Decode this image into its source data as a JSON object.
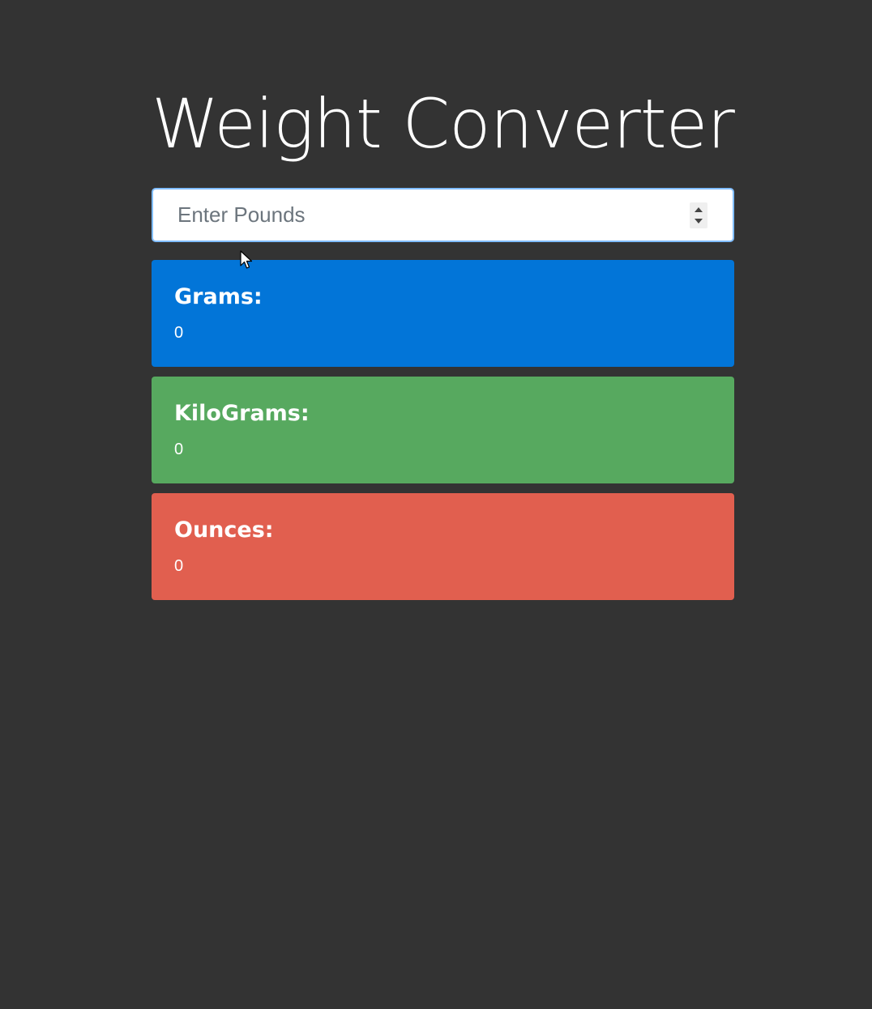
{
  "page": {
    "title": "Weight Converter",
    "background_color": "#333333"
  },
  "input": {
    "placeholder": "Enter Pounds",
    "value": ""
  },
  "results": [
    {
      "label": "Grams:",
      "value": "0",
      "color": "#0275d8"
    },
    {
      "label": "KiloGrams:",
      "value": "0",
      "color": "#57a95f"
    },
    {
      "label": "Ounces:",
      "value": "0",
      "color": "#e15f4f"
    }
  ],
  "icons": {
    "spinner": "number-spinner-icon",
    "cursor": "mouse-pointer-icon"
  }
}
